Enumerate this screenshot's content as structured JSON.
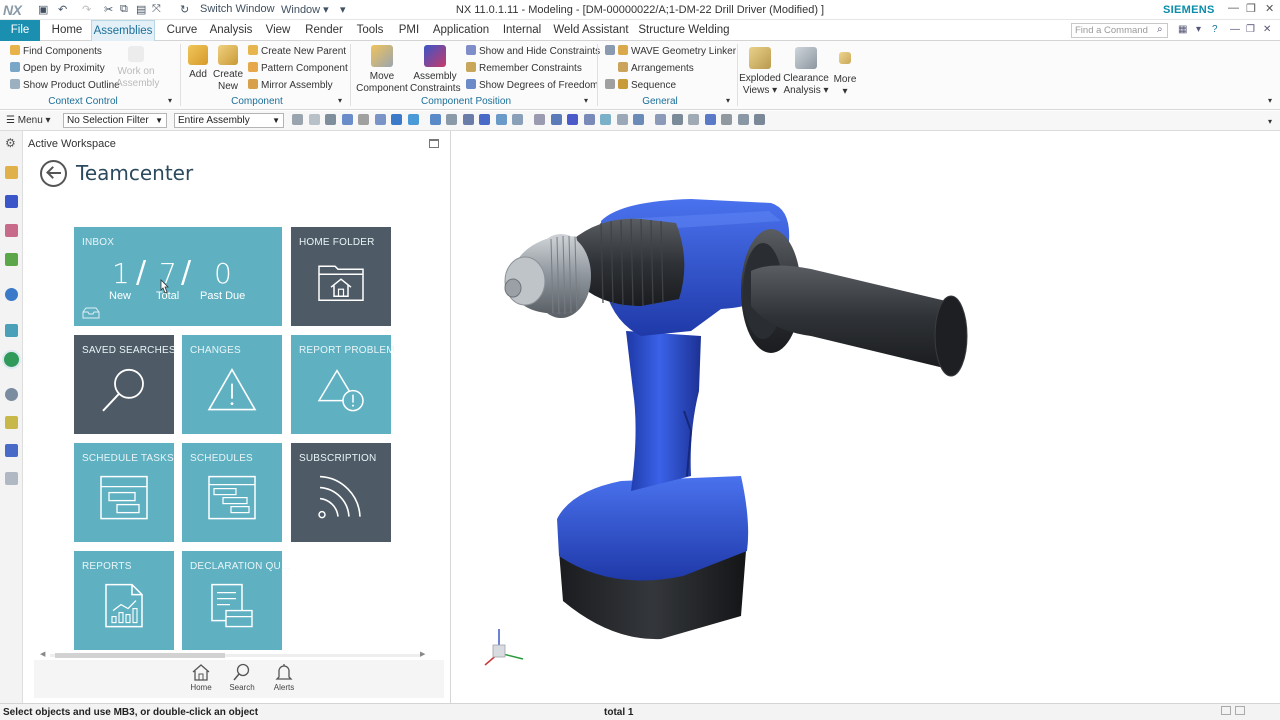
{
  "titlebar": {
    "logo": "NX",
    "switch_window": "Switch Window",
    "window_menu": "Window",
    "title": "NX 11.0.1.11 - Modeling - [DM-00000022/A;1-DM-22 Drill Driver (Modified) ]",
    "brand": "SIEMENS"
  },
  "tabs": [
    "File",
    "Home",
    "Assemblies",
    "Curve",
    "Analysis",
    "View",
    "Render",
    "Tools",
    "PMI",
    "Application",
    "Internal",
    "Weld Assistant",
    "Structure Welding"
  ],
  "active_tab": "Assemblies",
  "search": {
    "placeholder": "Find a Command"
  },
  "ribbon": {
    "context_control": {
      "items": [
        "Find Components",
        "Open by Proximity",
        "Show Product Outline"
      ],
      "work_on_assembly": "Work on Assembly",
      "label": "Context Control"
    },
    "component": {
      "add": "Add",
      "create_new": "Create New",
      "items": [
        "Create New Parent",
        "Pattern Component",
        "Mirror Assembly"
      ],
      "label": "Component"
    },
    "component_position": {
      "move": "Move Component",
      "constraints": "Assembly Constraints",
      "items": [
        "Show and Hide Constraints",
        "Remember Constraints",
        "Show Degrees of Freedom"
      ],
      "label": "Component Position"
    },
    "general": {
      "items": [
        "WAVE Geometry Linker",
        "Arrangements",
        "Sequence"
      ],
      "label": "General"
    },
    "exploded_views": "Exploded Views",
    "clearance_analysis": "Clearance Analysis",
    "more": "More"
  },
  "selection_bar": {
    "menu": "Menu",
    "filter": "No Selection Filter",
    "scope": "Entire Assembly"
  },
  "navigator": {
    "workspace_label": "Active Workspace",
    "title": "Teamcenter",
    "tiles": {
      "inbox": {
        "label": "INBOX",
        "new": "1",
        "total": "7",
        "past_due": "0",
        "new_cap": "New",
        "total_cap": "Total",
        "past_due_cap": "Past Due"
      },
      "home_folder": "HOME FOLDER",
      "saved_searches": "SAVED SEARCHES",
      "changes": "CHANGES",
      "report_problem": "REPORT PROBLEM",
      "schedule_tasks": "SCHEDULE TASKS",
      "schedules": "SCHEDULES",
      "subscription": "SUBSCRIPTION",
      "reports": "REPORTS",
      "declaration": "DECLARATION QU..."
    },
    "footer": {
      "home": "Home",
      "search": "Search",
      "alerts": "Alerts"
    }
  },
  "status": {
    "message": "Select objects and use MB3, or double-click an object",
    "total": "total 1"
  },
  "colors": {
    "accent": "#1b8fb0",
    "tile_teal": "#5fb1c2",
    "tile_slate": "#4e5a66",
    "drill_blue": "#2a4fd1"
  }
}
